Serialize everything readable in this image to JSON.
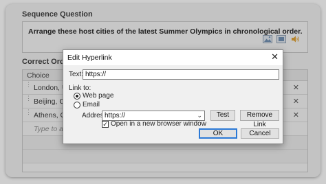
{
  "question": {
    "section_title": "Sequence Question",
    "text": "Arrange these host cities of the latest Summer Olympics in chronological order.",
    "icons": [
      "image-icon",
      "video-icon",
      "audio-icon"
    ]
  },
  "correct_order": {
    "section_title": "Correct Order",
    "column_header": "Choice",
    "rows": [
      {
        "text": "London, Uni"
      },
      {
        "text": "Beijing, Chi"
      },
      {
        "text": "Athens, Gre"
      }
    ],
    "placeholder": "Type to add"
  },
  "dialog": {
    "title": "Edit Hyperlink",
    "close_glyph": "✕",
    "text_label": "Text:",
    "text_value": "https://",
    "link_to_label": "Link to:",
    "option_web": "Web page",
    "option_email": "Email",
    "address_label": "Address:",
    "address_value": "https://",
    "test_label": "Test",
    "remove_label": "Remove Link",
    "new_window_label": "Open in a new browser window",
    "new_window_checked": "✓",
    "ok_label": "OK",
    "cancel_label": "Cancel"
  },
  "colors": {
    "accent": "#2b79d6"
  }
}
